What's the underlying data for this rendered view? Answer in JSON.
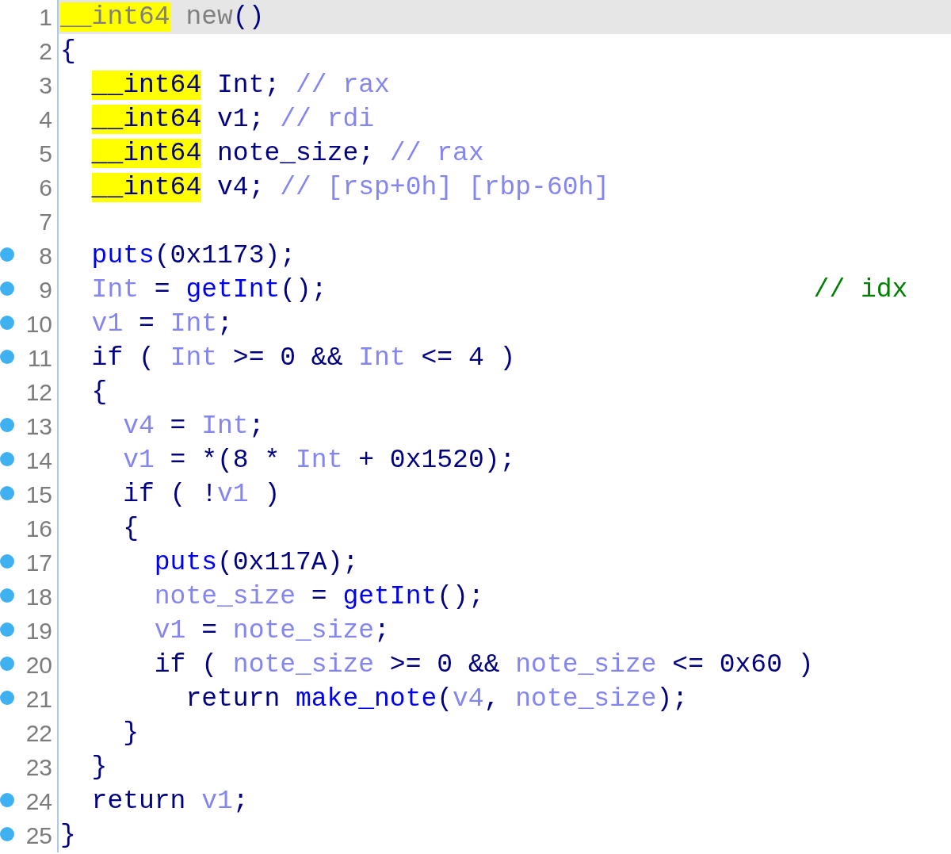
{
  "lines": [
    {
      "number": "1",
      "breakpoint": false,
      "current": true,
      "tokens": [
        {
          "text": "__int64",
          "kind": "muted",
          "highlight": true
        },
        {
          "text": " new",
          "kind": "muted",
          "highlight": false
        },
        {
          "text": "()",
          "kind": "plain",
          "highlight": false
        }
      ]
    },
    {
      "number": "2",
      "breakpoint": false,
      "current": false,
      "tokens": [
        {
          "text": "{",
          "kind": "plain",
          "highlight": false
        }
      ],
      "children": [
        {
          "number": "3",
          "breakpoint": false,
          "current": false,
          "tokens": [
            {
              "text": "__int64",
              "kind": "plain",
              "highlight": true
            },
            {
              "text": " Int; ",
              "kind": "plain",
              "highlight": false
            },
            {
              "text": "// rax",
              "kind": "comment",
              "highlight": false
            }
          ]
        },
        {
          "number": "4",
          "breakpoint": false,
          "current": false,
          "tokens": [
            {
              "text": "__int64",
              "kind": "plain",
              "highlight": true
            },
            {
              "text": " v1; ",
              "kind": "plain",
              "highlight": false
            },
            {
              "text": "// rdi",
              "kind": "comment",
              "highlight": false
            }
          ]
        },
        {
          "number": "5",
          "breakpoint": false,
          "current": false,
          "tokens": [
            {
              "text": "__int64",
              "kind": "plain",
              "highlight": true
            },
            {
              "text": " note_size; ",
              "kind": "plain",
              "highlight": false
            },
            {
              "text": "// rax",
              "kind": "comment",
              "highlight": false
            }
          ]
        },
        {
          "number": "6",
          "breakpoint": false,
          "current": false,
          "tokens": [
            {
              "text": "__int64",
              "kind": "plain",
              "highlight": true
            },
            {
              "text": " v4; ",
              "kind": "plain",
              "highlight": false
            },
            {
              "text": "// [rsp+0h] [rbp-60h]",
              "kind": "comment",
              "highlight": false
            }
          ]
        },
        {
          "number": "7",
          "breakpoint": false,
          "current": false
        },
        {
          "number": "8",
          "breakpoint": true,
          "current": false,
          "tokens": [
            {
              "text": "puts",
              "kind": "func",
              "highlight": false
            },
            {
              "text": "(0x1173);",
              "kind": "plain",
              "highlight": false
            }
          ]
        },
        {
          "number": "9",
          "breakpoint": true,
          "current": false,
          "tokens": [
            {
              "text": "Int",
              "kind": "var",
              "highlight": false
            },
            {
              "text": " = ",
              "kind": "plain",
              "highlight": false
            },
            {
              "text": "getInt",
              "kind": "func",
              "highlight": false
            },
            {
              "text": "();                               ",
              "kind": "plain",
              "highlight": false
            },
            {
              "text": "// idx",
              "kind": "note",
              "highlight": false
            }
          ]
        },
        {
          "number": "10",
          "breakpoint": true,
          "current": false,
          "tokens": [
            {
              "text": "v1",
              "kind": "var",
              "highlight": false
            },
            {
              "text": " = ",
              "kind": "plain",
              "highlight": false
            },
            {
              "text": "Int",
              "kind": "var",
              "highlight": false
            },
            {
              "text": ";",
              "kind": "plain",
              "highlight": false
            }
          ]
        },
        {
          "number": "11",
          "breakpoint": true,
          "current": false,
          "tokens": [
            {
              "text": "if ( ",
              "kind": "plain",
              "highlight": false
            },
            {
              "text": "Int",
              "kind": "var",
              "highlight": false
            },
            {
              "text": " >= 0 && ",
              "kind": "plain",
              "highlight": false
            },
            {
              "text": "Int",
              "kind": "var",
              "highlight": false
            },
            {
              "text": " <= 4 )",
              "kind": "plain",
              "highlight": false
            }
          ]
        },
        {
          "number": "12",
          "breakpoint": false,
          "current": false,
          "tokens": [
            {
              "text": "{",
              "kind": "plain",
              "highlight": false
            }
          ],
          "children": [
            {
              "number": "13",
              "breakpoint": true,
              "current": false,
              "tokens": [
                {
                  "text": "v4",
                  "kind": "var",
                  "highlight": false
                },
                {
                  "text": " = ",
                  "kind": "plain",
                  "highlight": false
                },
                {
                  "text": "Int",
                  "kind": "var",
                  "highlight": false
                },
                {
                  "text": ";",
                  "kind": "plain",
                  "highlight": false
                }
              ]
            },
            {
              "number": "14",
              "breakpoint": true,
              "current": false,
              "tokens": [
                {
                  "text": "v1",
                  "kind": "var",
                  "highlight": false
                },
                {
                  "text": " = *(8 * ",
                  "kind": "plain",
                  "highlight": false
                },
                {
                  "text": "Int",
                  "kind": "var",
                  "highlight": false
                },
                {
                  "text": " + 0x1520);",
                  "kind": "plain",
                  "highlight": false
                }
              ]
            },
            {
              "number": "15",
              "breakpoint": true,
              "current": false,
              "tokens": [
                {
                  "text": "if ( !",
                  "kind": "plain",
                  "highlight": false
                },
                {
                  "text": "v1",
                  "kind": "var",
                  "highlight": false
                },
                {
                  "text": " )",
                  "kind": "plain",
                  "highlight": false
                }
              ]
            },
            {
              "number": "16",
              "breakpoint": false,
              "current": false,
              "tokens": [
                {
                  "text": "{",
                  "kind": "plain",
                  "highlight": false
                }
              ],
              "children": [
                {
                  "number": "17",
                  "breakpoint": true,
                  "current": false,
                  "tokens": [
                    {
                      "text": "puts",
                      "kind": "func",
                      "highlight": false
                    },
                    {
                      "text": "(0x117A);",
                      "kind": "plain",
                      "highlight": false
                    }
                  ]
                },
                {
                  "number": "18",
                  "breakpoint": true,
                  "current": false,
                  "tokens": [
                    {
                      "text": "note_size",
                      "kind": "var",
                      "highlight": false
                    },
                    {
                      "text": " = ",
                      "kind": "plain",
                      "highlight": false
                    },
                    {
                      "text": "getInt",
                      "kind": "func",
                      "highlight": false
                    },
                    {
                      "text": "();",
                      "kind": "plain",
                      "highlight": false
                    }
                  ]
                },
                {
                  "number": "19",
                  "breakpoint": true,
                  "current": false,
                  "tokens": [
                    {
                      "text": "v1",
                      "kind": "var",
                      "highlight": false
                    },
                    {
                      "text": " = ",
                      "kind": "plain",
                      "highlight": false
                    },
                    {
                      "text": "note_size",
                      "kind": "var",
                      "highlight": false
                    },
                    {
                      "text": ";",
                      "kind": "plain",
                      "highlight": false
                    }
                  ]
                },
                {
                  "number": "20",
                  "breakpoint": true,
                  "current": false,
                  "tokens": [
                    {
                      "text": "if ( ",
                      "kind": "plain",
                      "highlight": false
                    },
                    {
                      "text": "note_size",
                      "kind": "var",
                      "highlight": false
                    },
                    {
                      "text": " >= 0 && ",
                      "kind": "plain",
                      "highlight": false
                    },
                    {
                      "text": "note_size",
                      "kind": "var",
                      "highlight": false
                    },
                    {
                      "text": " <= 0x60 )",
                      "kind": "plain",
                      "highlight": false
                    }
                  ],
                  "children": [
                    {
                      "number": "21",
                      "breakpoint": true,
                      "current": false,
                      "tokens": [
                        {
                          "text": "return ",
                          "kind": "plain",
                          "highlight": false
                        },
                        {
                          "text": "make_note",
                          "kind": "func",
                          "highlight": false
                        },
                        {
                          "text": "(",
                          "kind": "plain",
                          "highlight": false
                        },
                        {
                          "text": "v4",
                          "kind": "var",
                          "highlight": false
                        },
                        {
                          "text": ", ",
                          "kind": "plain",
                          "highlight": false
                        },
                        {
                          "text": "note_size",
                          "kind": "var",
                          "highlight": false
                        },
                        {
                          "text": ");",
                          "kind": "plain",
                          "highlight": false
                        }
                      ]
                    }
                  ]
                }
              ]
            },
            {
              "number": "22",
              "breakpoint": false,
              "current": false,
              "tokens": [
                {
                  "text": "}",
                  "kind": "plain",
                  "highlight": false
                }
              ]
            }
          ]
        },
        {
          "number": "23",
          "breakpoint": false,
          "current": false,
          "tokens": [
            {
              "text": "}",
              "kind": "plain",
              "highlight": false
            }
          ]
        },
        {
          "number": "24",
          "breakpoint": true,
          "current": false,
          "tokens": [
            {
              "text": "return ",
              "kind": "plain",
              "highlight": false
            },
            {
              "text": "v1",
              "kind": "var",
              "highlight": false
            },
            {
              "text": ";",
              "kind": "plain",
              "highlight": false
            }
          ]
        }
      ]
    },
    {
      "number": "25",
      "breakpoint": true,
      "current": false,
      "tokens": [
        {
          "text": "}",
          "kind": "plain",
          "highlight": false
        }
      ]
    }
  ]
}
